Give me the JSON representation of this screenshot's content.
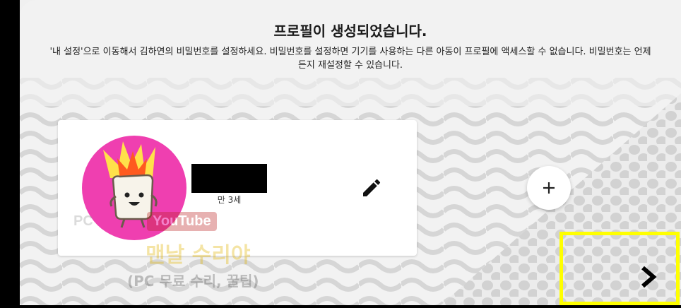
{
  "header": {
    "title": "프로필이 생성되었습니다.",
    "description": "'내 설정'으로 이동해서 김하연의 비밀번호를 설정하세요. 비밀번호를 설정하면 기기를 사용하는 다른 아동이 프로필에 액세스할 수 없습니다. 비밀번호는 언제든지 재설정할 수 있습니다."
  },
  "profile": {
    "age": "만 3세",
    "avatar_icon": "flaming-marshmallow-avatar",
    "avatar_bg": "#ef3fb0"
  },
  "actions": {
    "edit_icon": "pencil-icon",
    "add_label": "+",
    "next_icon": "chevron-right-icon"
  },
  "watermark": {
    "pc": "PC",
    "youtube": "YouTube",
    "title": "맨날 수리야",
    "subtitle": "(PC 무료 수리, 꿀팁)"
  },
  "colors": {
    "highlight": "#ffff00",
    "background": "#f2f2f2"
  }
}
